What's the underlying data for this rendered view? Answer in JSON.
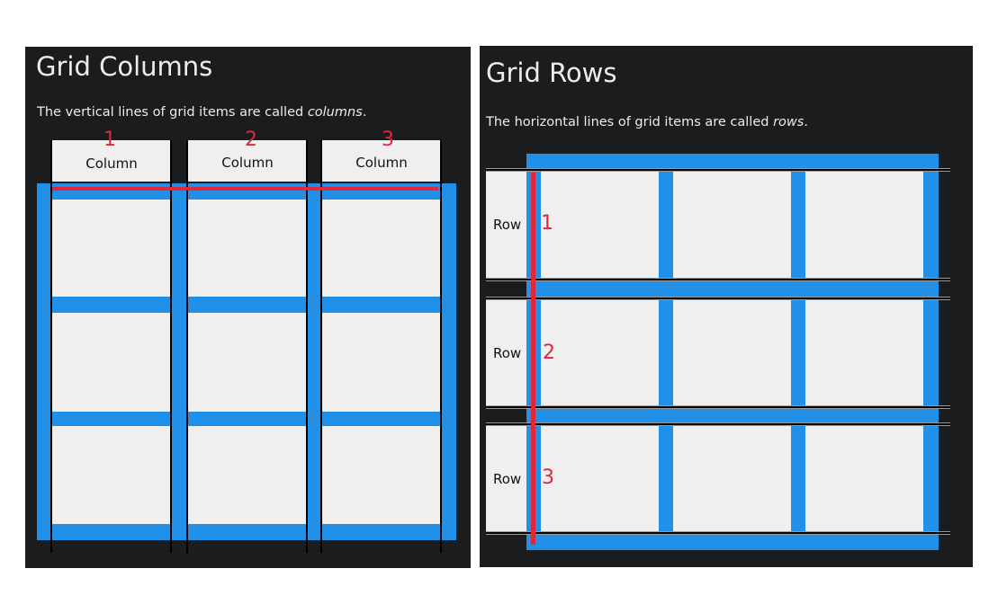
{
  "columns_panel": {
    "title": "Grid Columns",
    "description_prefix": "The vertical lines of grid items are called ",
    "description_term": "columns",
    "description_suffix": ".",
    "column_label": "Column",
    "numbers": [
      "1",
      "2",
      "3"
    ]
  },
  "rows_panel": {
    "title": "Grid Rows",
    "description_prefix": "The horizontal lines of grid items are called ",
    "description_term": "rows",
    "description_suffix": ".",
    "row_label": "Row",
    "numbers": [
      "1",
      "2",
      "3"
    ]
  },
  "colors": {
    "background": "#1b1c1e",
    "grid_gap": "#2190e6",
    "grid_cell": "#efefef",
    "highlight": "#e0283a",
    "text": "#ececec"
  }
}
